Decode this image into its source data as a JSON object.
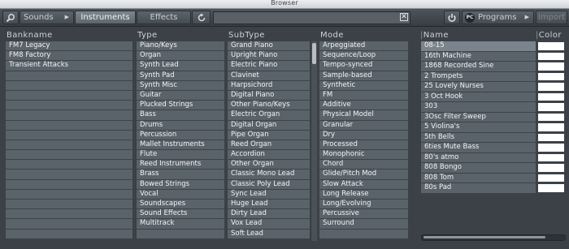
{
  "window": {
    "title": "Browser"
  },
  "toolbar": {
    "sounds": "Sounds",
    "instruments": "Instruments",
    "effects": "Effects",
    "programs": "Programs",
    "import": "Import",
    "search_placeholder": "",
    "search_value": ""
  },
  "columns": {
    "bankname": {
      "header": "Bankname",
      "items": [
        "FM7 Legacy",
        "FM8 Factory",
        "Transient Attacks"
      ]
    },
    "type": {
      "header": "Type",
      "items": [
        "Piano/Keys",
        "Organ",
        "Synth Lead",
        "Synth Pad",
        "Synth Misc",
        "Guitar",
        "Plucked Strings",
        "Bass",
        "Drums",
        "Percussion",
        "Mallet Instruments",
        "Flute",
        "Reed Instruments",
        "Brass",
        "Bowed Strings",
        "Vocal",
        "Soundscapes",
        "Sound Effects",
        "Multitrack"
      ]
    },
    "subtype": {
      "header": "SubType",
      "items": [
        "Grand Piano",
        "Upright Piano",
        "Electric Piano",
        "Clavinet",
        "Harpsichord",
        "Digital Piano",
        "Other Piano/Keys",
        "Electric Organ",
        "Digital Organ",
        "Pipe Organ",
        "Reed Organ",
        "Accordion",
        "Other Organ",
        "Classic Mono Lead",
        "Classic Poly Lead",
        "Sync Lead",
        "Huge Lead",
        "Dirty Lead",
        "Vox Lead",
        "Soft Lead"
      ]
    },
    "mode": {
      "header": "Mode",
      "items": [
        "Arpeggiated",
        "Sequence/Loop",
        "Tempo-synced",
        "Sample-based",
        "Synthetic",
        "FM",
        "Additive",
        "Physical Model",
        "Granular",
        "Dry",
        "Processed",
        "Monophonic",
        "Chord",
        "Glide/Pitch Mod",
        "Slow Attack",
        "Long Release",
        "Long/Evolving",
        "Percussive",
        "Surround"
      ]
    }
  },
  "results": {
    "name_header": "Name",
    "color_header": "Color",
    "items": [
      "08-15",
      "16th Machine",
      "1868 Recorded Sine",
      "2 Trompets",
      "25 Lovely Nurses",
      "3 Oct Hook",
      "303",
      "3Osc Filter Sweep",
      "5 Violina's",
      "5th Bells",
      "6ties Mute Bass",
      "80's atmo",
      "808 Bongo",
      "808 Tom",
      "80s Pad"
    ],
    "selected_index": 0,
    "swatch_color": "#ffffff"
  },
  "icons": {
    "search": "search-icon",
    "play": "play-triangle-icon",
    "refresh": "refresh-icon",
    "clear": "clear-x-icon",
    "power": "power-icon",
    "pc": "pc-badge-icon"
  }
}
